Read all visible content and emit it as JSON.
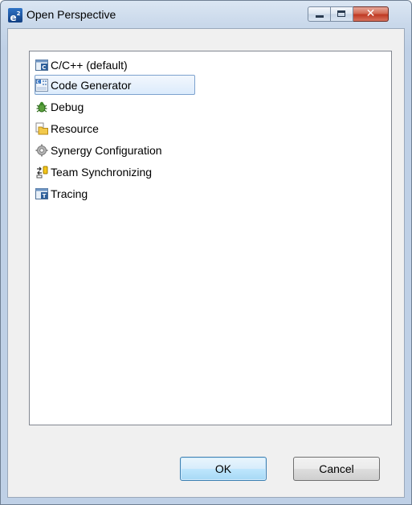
{
  "window": {
    "title": "Open Perspective",
    "app_icon": "e²",
    "controls": {
      "minimize": "minimize-icon",
      "maximize": "maximize-icon",
      "close": "close-icon"
    }
  },
  "perspectives": [
    {
      "label": "C/C++ (default)",
      "icon": "cpp-perspective-icon",
      "selected": false
    },
    {
      "label": "Code Generator",
      "icon": "code-generator-icon",
      "selected": true
    },
    {
      "label": "Debug",
      "icon": "debug-bug-icon",
      "selected": false
    },
    {
      "label": "Resource",
      "icon": "resource-folder-icon",
      "selected": false
    },
    {
      "label": "Synergy Configuration",
      "icon": "synergy-gear-icon",
      "selected": false
    },
    {
      "label": "Team Synchronizing",
      "icon": "team-sync-icon",
      "selected": false
    },
    {
      "label": "Tracing",
      "icon": "tracing-icon",
      "selected": false
    }
  ],
  "buttons": {
    "ok": "OK",
    "cancel": "Cancel"
  },
  "colors": {
    "selection_border": "#7da2ce",
    "ok_border": "#3c7fb1",
    "close_red": "#c7432c"
  }
}
